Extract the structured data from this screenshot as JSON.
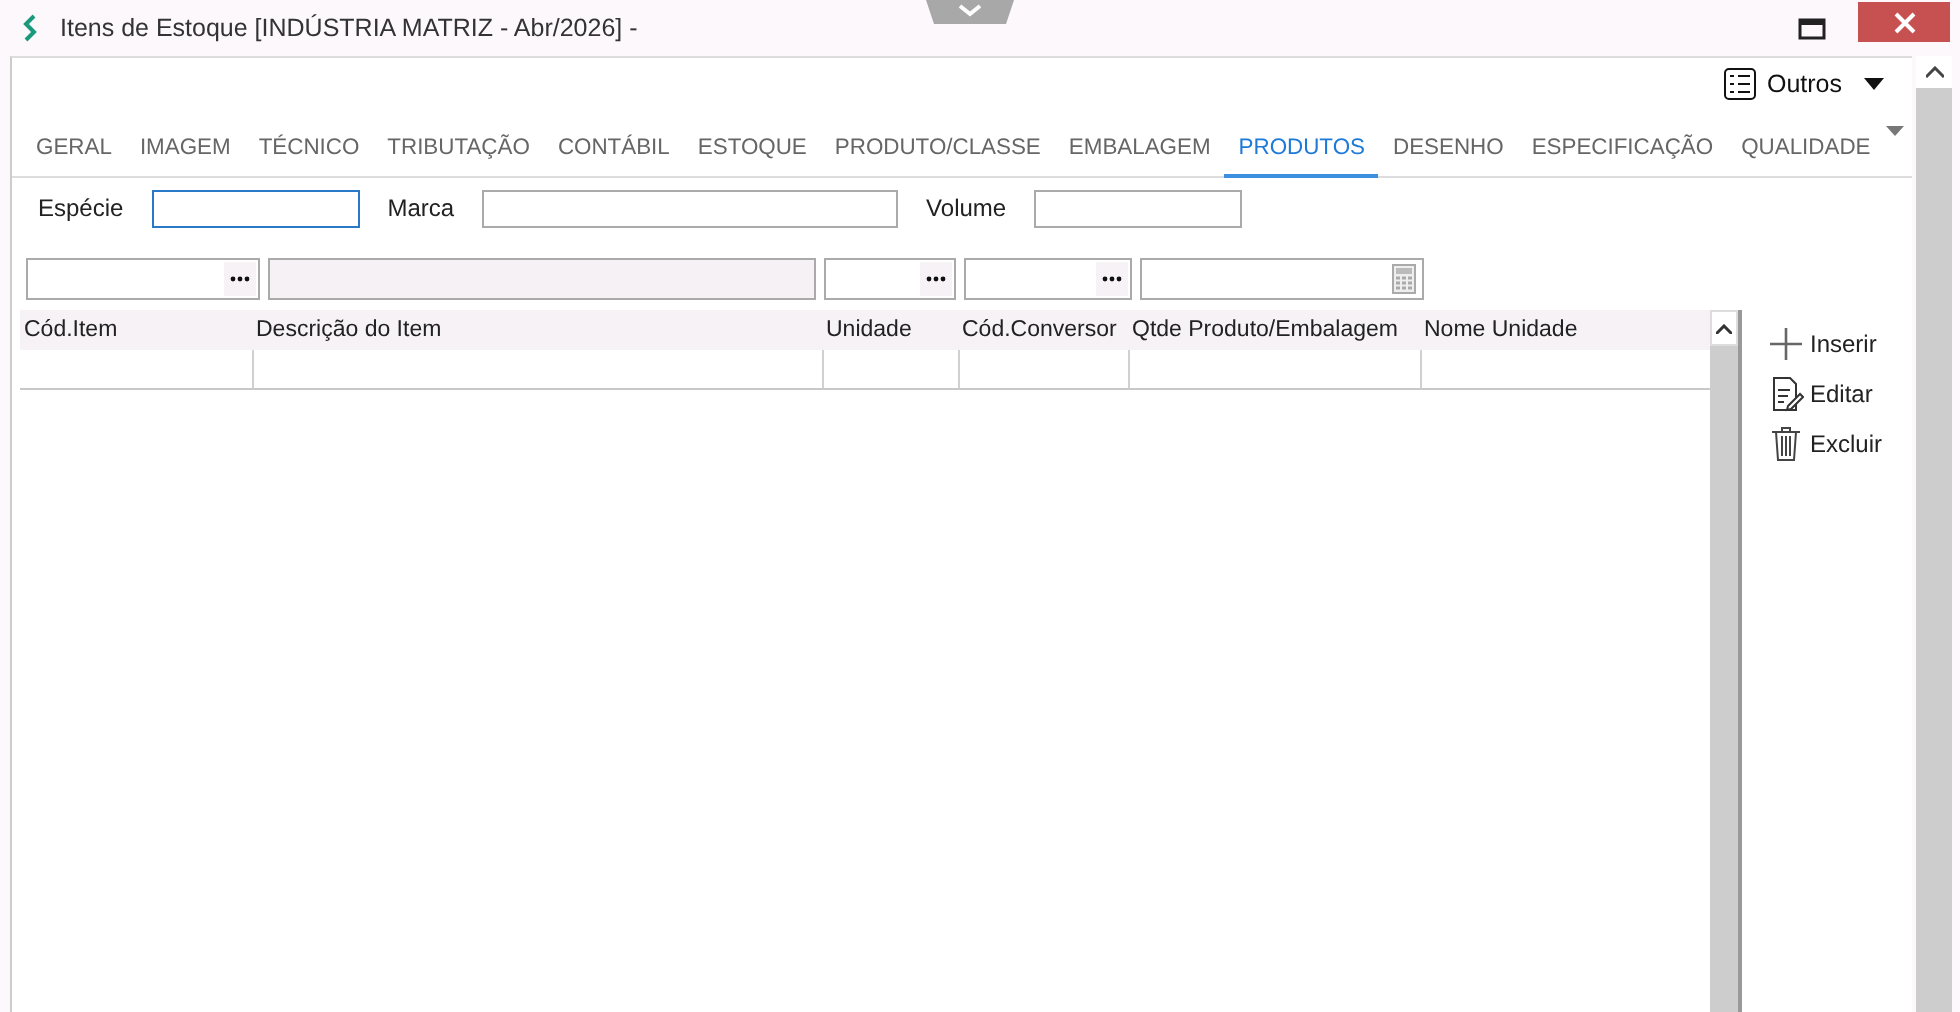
{
  "window": {
    "title": "Itens de Estoque [INDÚSTRIA MATRIZ - Abr/2026]  -"
  },
  "toolbar": {
    "menu_label": "Outros"
  },
  "tabs": [
    {
      "label": "GERAL",
      "selected": false
    },
    {
      "label": "IMAGEM",
      "selected": false
    },
    {
      "label": "TÉCNICO",
      "selected": false
    },
    {
      "label": "TRIBUTAÇÃO",
      "selected": false
    },
    {
      "label": "CONTÁBIL",
      "selected": false
    },
    {
      "label": "ESTOQUE",
      "selected": false
    },
    {
      "label": "PRODUTO/CLASSE",
      "selected": false
    },
    {
      "label": "EMBALAGEM",
      "selected": false
    },
    {
      "label": "PRODUTOS",
      "selected": true
    },
    {
      "label": "DESENHO",
      "selected": false
    },
    {
      "label": "ESPECIFICAÇÃO",
      "selected": false
    },
    {
      "label": "QUALIDADE",
      "selected": false
    }
  ],
  "form": {
    "fields": [
      {
        "label": "Espécie",
        "focused": true
      },
      {
        "label": "Marca",
        "focused": false
      },
      {
        "label": "Volume",
        "focused": false
      }
    ]
  },
  "filters": [
    {
      "kind": "lookup",
      "disabled": false
    },
    {
      "kind": "text",
      "disabled": true
    },
    {
      "kind": "lookup",
      "disabled": false
    },
    {
      "kind": "lookup",
      "disabled": false
    },
    {
      "kind": "number",
      "disabled": false
    }
  ],
  "table": {
    "columns": [
      "Cód.Item",
      "Descrição do Item",
      "Unidade",
      "Cód.Conversor",
      "Qtde Produto/Embalagem",
      "Nome Unidade"
    ]
  },
  "actions": [
    {
      "kind": "add",
      "label": "Inserir"
    },
    {
      "kind": "edit",
      "label": "Editar"
    },
    {
      "kind": "delete",
      "label": "Excluir"
    }
  ]
}
